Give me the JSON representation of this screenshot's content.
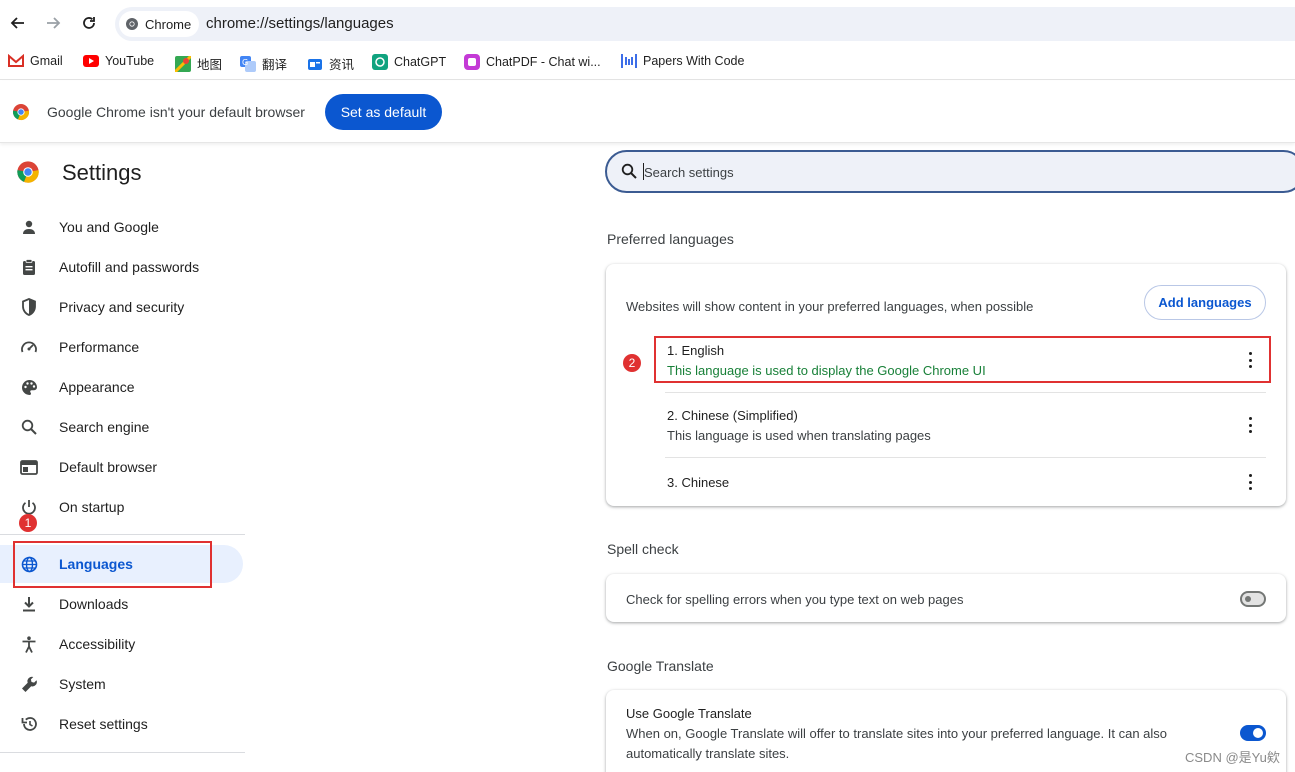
{
  "toolbar": {
    "chip_label": "Chrome",
    "url": "chrome://settings/languages"
  },
  "bookmarks": [
    {
      "label": "Gmail",
      "color": "#d93025"
    },
    {
      "label": "YouTube",
      "color": "#ff0000"
    },
    {
      "label": "地图",
      "color": "#34a853"
    },
    {
      "label": "翻译",
      "color": "#4285f4"
    },
    {
      "label": "资讯",
      "color": "#1a73e8"
    },
    {
      "label": "ChatGPT",
      "color": "#10a37f"
    },
    {
      "label": "ChatPDF - Chat wi...",
      "color": "#c43ad6"
    },
    {
      "label": "Papers With Code",
      "color": "#3d6ee8"
    }
  ],
  "infobar": {
    "message": "Google Chrome isn't your default browser",
    "button": "Set as default"
  },
  "sidebar": {
    "title": "Settings",
    "items": [
      {
        "label": "You and Google",
        "icon": "person-icon"
      },
      {
        "label": "Autofill and passwords",
        "icon": "clipboard-icon"
      },
      {
        "label": "Privacy and security",
        "icon": "shield-icon"
      },
      {
        "label": "Performance",
        "icon": "speedometer-icon"
      },
      {
        "label": "Appearance",
        "icon": "palette-icon"
      },
      {
        "label": "Search engine",
        "icon": "search-icon"
      },
      {
        "label": "Default browser",
        "icon": "browser-window-icon"
      },
      {
        "label": "On startup",
        "icon": "power-icon"
      },
      {
        "label": "Languages",
        "icon": "globe-icon",
        "active": true
      },
      {
        "label": "Downloads",
        "icon": "download-icon"
      },
      {
        "label": "Accessibility",
        "icon": "accessibility-icon"
      },
      {
        "label": "System",
        "icon": "wrench-icon"
      },
      {
        "label": "Reset settings",
        "icon": "reset-icon"
      }
    ]
  },
  "annotations": {
    "badge_1": "1",
    "badge_2": "2",
    "color": "#e03131"
  },
  "search": {
    "placeholder": "Search settings"
  },
  "preferred_languages": {
    "title": "Preferred languages",
    "description": "Websites will show content in your preferred languages, when possible",
    "add_button": "Add languages",
    "languages": [
      {
        "name": "1. English",
        "note": "This language is used to display the Google Chrome UI",
        "note_color": "#188038"
      },
      {
        "name": "2. Chinese (Simplified)",
        "note": "This language is used when translating pages"
      },
      {
        "name": "3. Chinese",
        "note": ""
      }
    ]
  },
  "spell_check": {
    "title": "Spell check",
    "label": "Check for spelling errors when you type text on web pages",
    "enabled": false
  },
  "google_translate": {
    "title": "Google Translate",
    "label": "Use Google Translate",
    "description_line1": "When on, Google Translate will offer to translate sites into your preferred language. It can also",
    "description_line2": "automatically translate sites.",
    "enabled": true
  },
  "watermark": "CSDN @是Yu欸",
  "colors": {
    "accent": "#0b57d0",
    "active_nav_bg": "#e8f0fe"
  }
}
